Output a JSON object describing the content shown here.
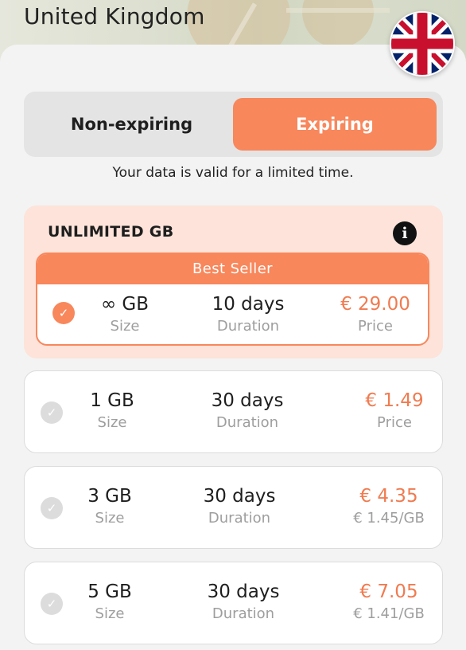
{
  "header": {
    "country": "United Kingdom",
    "flag_icon": "uk-flag-icon"
  },
  "toggle": {
    "non_expiring": "Non-expiring",
    "expiring": "Expiring",
    "selected": "Expiring"
  },
  "hint": "Your data is valid for a limited time.",
  "featured": {
    "title": "UNLIMITED GB",
    "badge": "Best Seller",
    "size": "∞ GB",
    "size_label": "Size",
    "duration": "10 days",
    "duration_label": "Duration",
    "price": "€ 29.00",
    "price_label": "Price"
  },
  "plans": [
    {
      "size": "1 GB",
      "size_label": "Size",
      "duration": "30 days",
      "duration_label": "Duration",
      "price": "€ 1.49",
      "price_sub": "Price"
    },
    {
      "size": "3 GB",
      "size_label": "Size",
      "duration": "30 days",
      "duration_label": "Duration",
      "price": "€ 4.35",
      "price_sub": "€ 1.45/GB"
    },
    {
      "size": "5 GB",
      "size_label": "Size",
      "duration": "30 days",
      "duration_label": "Duration",
      "price": "€ 7.05",
      "price_sub": "€ 1.41/GB"
    }
  ],
  "colors": {
    "accent": "#f8875c",
    "price": "#f07b50",
    "featured_bg": "#fde3d9"
  }
}
